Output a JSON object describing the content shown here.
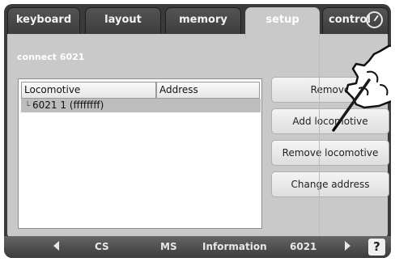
{
  "tabs": [
    {
      "label": "keyboard"
    },
    {
      "label": "layout"
    },
    {
      "label": "memory"
    },
    {
      "label": "setup",
      "active": true
    },
    {
      "label": "control"
    }
  ],
  "panel": {
    "title": "connect 6021",
    "list": {
      "columns": [
        "Locomotive",
        "Address"
      ],
      "rows": [
        {
          "label": "6021 1 (ffffffff)"
        }
      ]
    },
    "buttons": {
      "remove": "Remove",
      "add_locomotive": "Add locomotive",
      "remove_locomotive": "Remove locomotive",
      "change_address": "Change address"
    }
  },
  "bottom_bar": {
    "cs": "CS",
    "ms": "MS",
    "information": "Information",
    "device": "6021",
    "help": "?"
  },
  "colors": {
    "frame": "#3a3a3a",
    "panel": "#c9c9c9",
    "selected_row": "#bdbdbd"
  },
  "icons": [
    "clock-icon",
    "arrow-left-icon",
    "arrow-right-icon",
    "help-icon",
    "tree-branch-icon",
    "hand-pointer-icon"
  ]
}
